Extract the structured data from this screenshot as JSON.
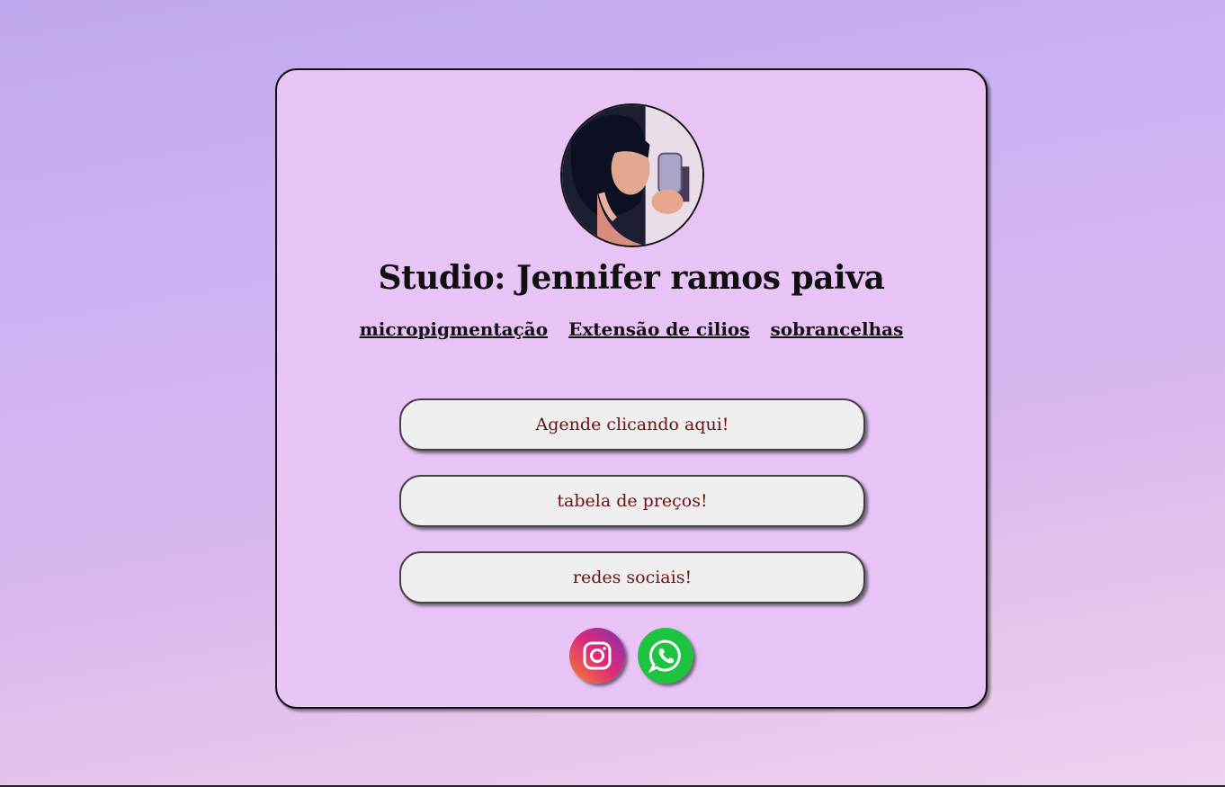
{
  "profile": {
    "title": "Studio: Jennifer ramos paiva"
  },
  "services": [
    {
      "label": "micropigmentação"
    },
    {
      "label": "Extensão de cilios"
    },
    {
      "label": "sobrancelhas"
    }
  ],
  "buttons": [
    {
      "label": "Agende clicando aqui!"
    },
    {
      "label": "tabela de preços!"
    },
    {
      "label": "redes sociais!"
    }
  ],
  "socials": [
    {
      "icon": "instagram-icon"
    },
    {
      "icon": "whatsapp-icon"
    }
  ],
  "colors": {
    "card_background": "#e8c3f6",
    "button_background": "#efefef",
    "button_text": "#6b1010",
    "instagram_gradient": [
      "#f58529",
      "#dd2a7b",
      "#8134af"
    ],
    "whatsapp": "#1ec43f"
  }
}
